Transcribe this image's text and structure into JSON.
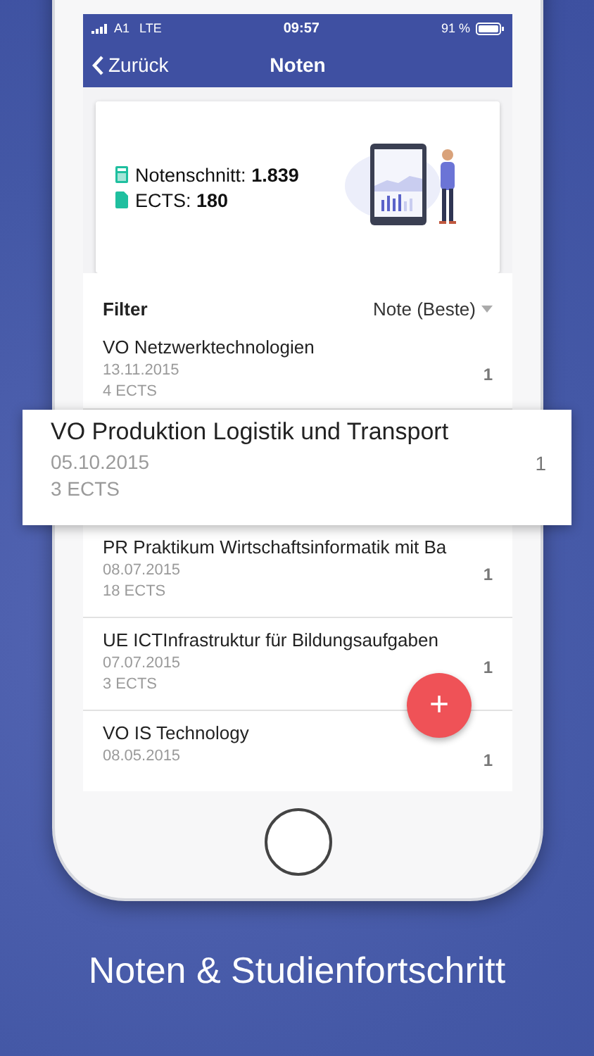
{
  "status_bar": {
    "carrier": "A1",
    "network": "LTE",
    "time": "09:57",
    "battery": "91 %"
  },
  "nav": {
    "back": "Zurück",
    "title": "Noten"
  },
  "summary": [
    {
      "kind": "average",
      "label": "Notenschnitt:",
      "value": "1.839"
    },
    {
      "kind": "ects",
      "label": "ECTS:",
      "value": "180"
    }
  ],
  "filter": {
    "label": "Filter",
    "value": "Note (Beste)"
  },
  "courses": [
    {
      "title": "VO Netzwerktechnologien",
      "date": "13.11.2015",
      "ects": "4 ECTS",
      "grade": "1",
      "highlighted": false
    },
    {
      "title": "VO Produktion Logistik und Transport",
      "date": "05.10.2015",
      "ects": "3 ECTS",
      "grade": "1",
      "highlighted": true
    },
    {
      "title": "PR Praktikum Wirtschaftsinformatik mit Ba",
      "date": "08.07.2015",
      "ects": "18 ECTS",
      "grade": "1",
      "highlighted": false
    },
    {
      "title": "UE ICTInfrastruktur für Bildungsaufgaben",
      "date": "07.07.2015",
      "ects": "3 ECTS",
      "grade": "1",
      "highlighted": false
    },
    {
      "title": "VO IS Technology",
      "date": "08.05.2015",
      "grade": "1",
      "highlighted": false
    }
  ],
  "fab": {
    "label": "+"
  },
  "caption": "Noten & Studienfortschritt"
}
